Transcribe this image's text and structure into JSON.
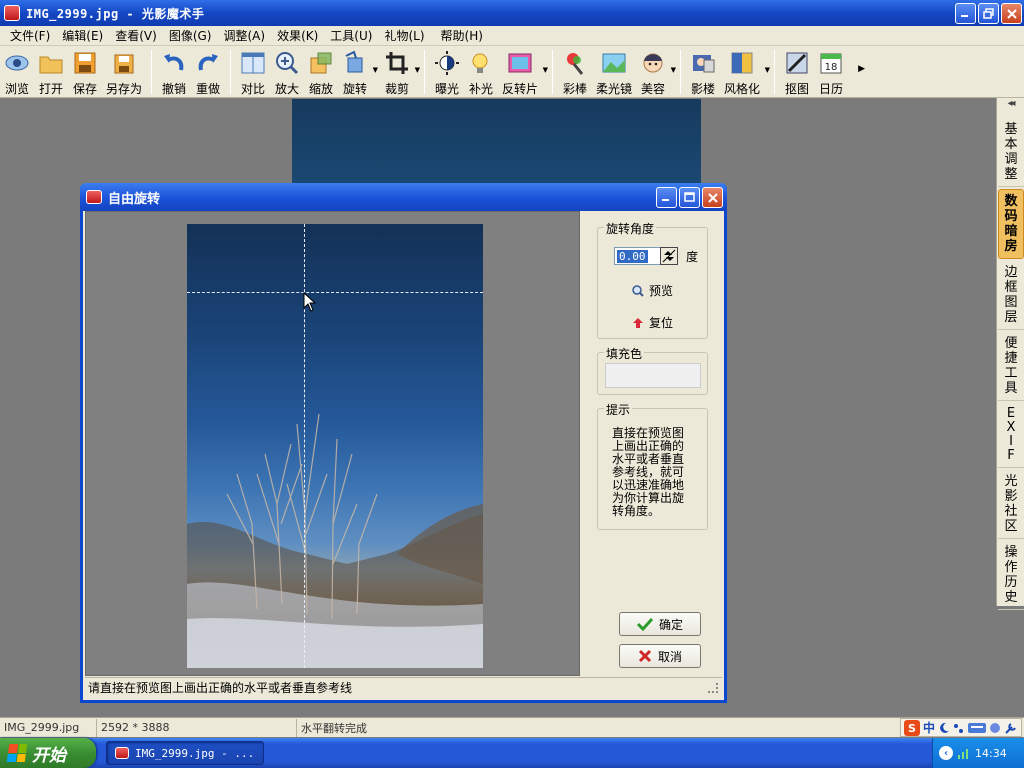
{
  "window": {
    "title": "IMG_2999.jpg - 光影魔术手"
  },
  "menu": [
    "文件(F)",
    "编辑(E)",
    "查看(V)",
    "图像(G)",
    "调整(A)",
    "效果(K)",
    "工具(U)",
    "礼物(L)",
    "帮助(H)"
  ],
  "toolbar": {
    "items": [
      {
        "label": "浏览",
        "icon": "browse-icon"
      },
      {
        "label": "打开",
        "icon": "folder-open-icon"
      },
      {
        "label": "保存",
        "icon": "save-icon"
      },
      {
        "label": "另存为",
        "icon": "save-as-icon"
      },
      {
        "label": "撤销",
        "icon": "undo-icon"
      },
      {
        "label": "重做",
        "icon": "redo-icon"
      },
      {
        "label": "对比",
        "icon": "compare-icon"
      },
      {
        "label": "放大",
        "icon": "zoom-in-icon"
      },
      {
        "label": "缩放",
        "icon": "resize-icon"
      },
      {
        "label": "旋转",
        "icon": "rotate-icon"
      },
      {
        "label": "裁剪",
        "icon": "crop-icon"
      },
      {
        "label": "曝光",
        "icon": "exposure-icon"
      },
      {
        "label": "补光",
        "icon": "fill-light-icon"
      },
      {
        "label": "反转片",
        "icon": "reversal-film-icon"
      },
      {
        "label": "彩棒",
        "icon": "color-wand-icon"
      },
      {
        "label": "柔光镜",
        "icon": "soft-light-icon"
      },
      {
        "label": "美容",
        "icon": "beauty-icon"
      },
      {
        "label": "影楼",
        "icon": "studio-icon"
      },
      {
        "label": "风格化",
        "icon": "stylize-icon"
      },
      {
        "label": "抠图",
        "icon": "cutout-icon"
      },
      {
        "label": "日历",
        "icon": "calendar-icon"
      }
    ],
    "calendar_day": "18"
  },
  "right_panel": {
    "collapse_glyph": "◂◂",
    "tabs": [
      "基本调整",
      "数码暗房",
      "边框图层",
      "便捷工具",
      "EXIF",
      "光影社区",
      "操作历史"
    ],
    "active_tab": "数码暗房"
  },
  "dialog": {
    "title": "自由旋转",
    "angle_group": "旋转角度",
    "angle_value": "0.00",
    "angle_unit": "度",
    "preview_label": "预览",
    "reset_label": "复位",
    "fill_group": "填充色",
    "fill_color": "#f0f0f0",
    "tips_group": "提示",
    "tips_text": "直接在预览图上画出正确的水平或者垂直参考线，就可以迅速准确地为你计算出旋转角度。",
    "ok_label": "确定",
    "cancel_label": "取消",
    "status_text": "请直接在预览图上画出正确的水平或者垂直参考线"
  },
  "statusbar": {
    "filename": "IMG_2999.jpg",
    "dimensions": "2592 * 3888",
    "message": "水平翻转完成",
    "ime_mode": "中"
  },
  "taskbar": {
    "start_label": "开始",
    "task_title": "IMG_2999.jpg - ...",
    "clock": "14:34"
  }
}
